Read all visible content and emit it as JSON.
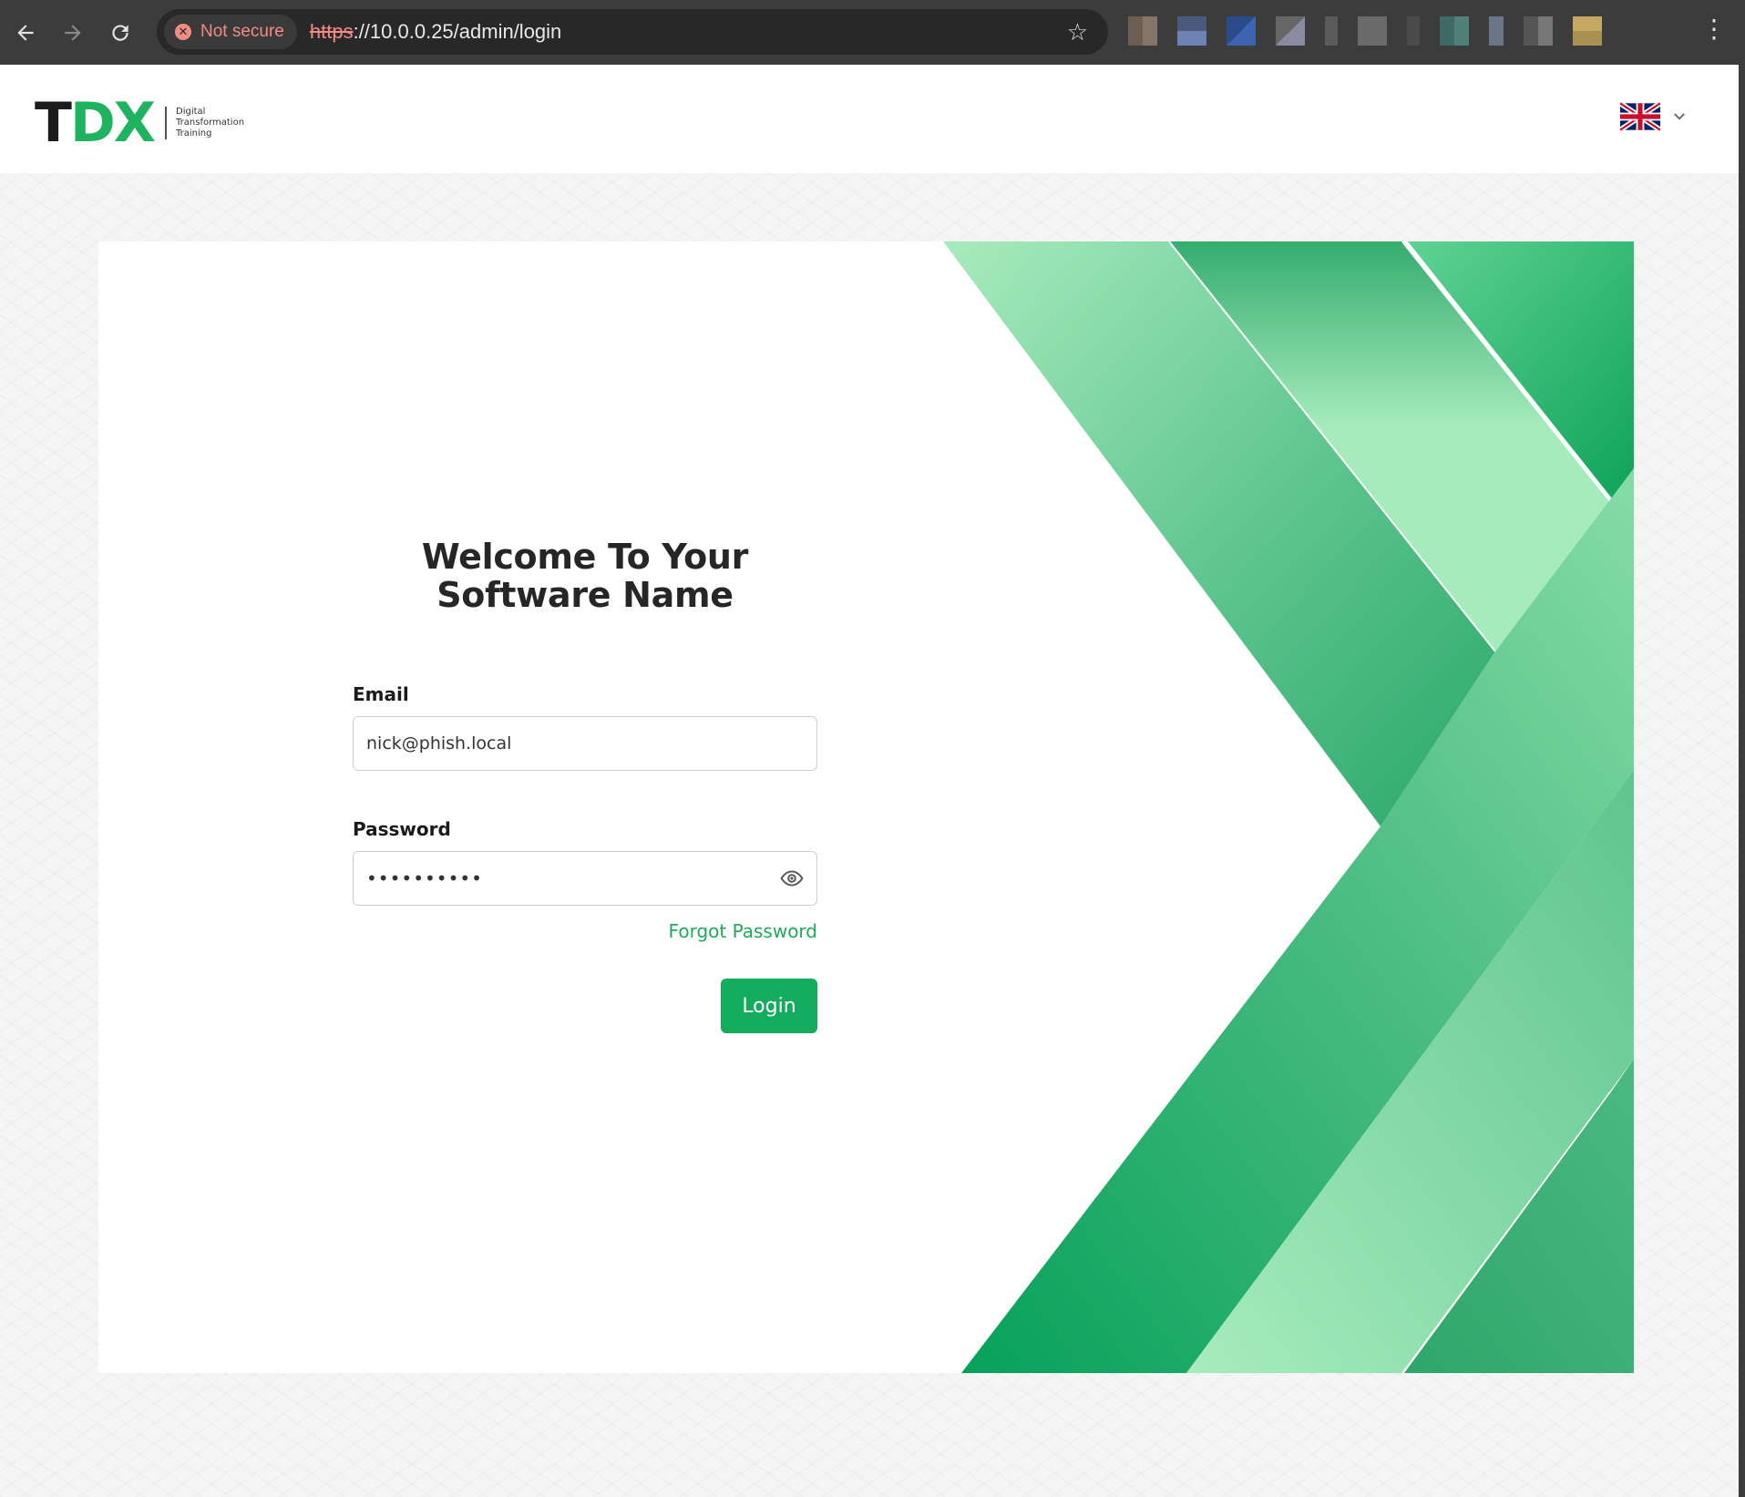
{
  "browser": {
    "security_label": "Not secure",
    "url_scheme": "https",
    "url_rest": "://10.0.0.25/admin/login"
  },
  "header": {
    "logo_t": "T",
    "logo_dx": "DX",
    "logo_sub": [
      "Digital",
      "Transformation",
      "Training"
    ],
    "language": "English (UK)"
  },
  "login": {
    "title_line1": "Welcome To Your",
    "title_line2": "Software Name",
    "email_label": "Email",
    "email_value": "nick@phish.local",
    "password_label": "Password",
    "password_masked": "••••••••••",
    "forgot_link": "Forgot Password",
    "login_button": "Login"
  },
  "colors": {
    "accent": "#12ad5c",
    "link": "#1fa95a",
    "chrome": "#3c3c3c"
  }
}
